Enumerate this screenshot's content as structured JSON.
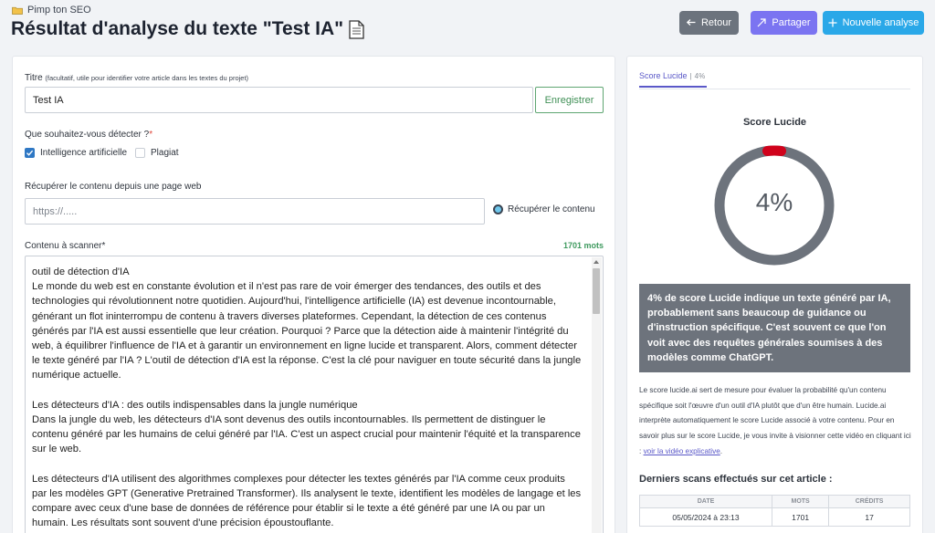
{
  "breadcrumb": {
    "label": "Pimp ton SEO"
  },
  "page": {
    "title": "Résultat d'analyse du texte \"Test IA\""
  },
  "toolbar": {
    "back_label": "Retour",
    "share_label": "Partager",
    "new_label": "Nouvelle analyse"
  },
  "form": {
    "title_label": "Titre",
    "title_hint": "(facultatif, utile pour identifier votre article dans les textes du projet)",
    "title_value": "Test IA",
    "save_label": "Enregistrer",
    "detect_label": "Que souhaitez-vous détecter ?",
    "required_mark": "*",
    "options": [
      {
        "label": "Intelligence artificielle",
        "checked": true
      },
      {
        "label": "Plagiat",
        "checked": false
      }
    ],
    "url_label": "Récupérer le contenu depuis une page web",
    "url_placeholder": "https://.....",
    "fetch_label": "Récupérer le contenu",
    "content_label": "Contenu à scanner*",
    "word_count": "1701 mots",
    "content_paragraphs": [
      "outil de détection d'IA\nLe monde du web est en constante évolution et il n'est pas rare de voir émerger des tendances, des outils et des technologies qui révolutionnent notre quotidien. Aujourd'hui, l'intelligence artificielle (IA) est devenue incontournable, générant un flot ininterrompu de contenu à travers diverses plateformes. Cependant, la détection de ces contenus générés par l'IA est aussi essentielle que leur création. Pourquoi ? Parce que la détection aide à maintenir l'intégrité du web, à équilibrer l'influence de l'IA et à garantir un environnement en ligne lucide et transparent. Alors, comment détecter le texte généré par l'IA ? L'outil de détection d'IA est la réponse. C'est la clé pour naviguer en toute sécurité dans la jungle numérique actuelle.",
      "Les détecteurs d'IA : des outils indispensables dans la jungle numérique\nDans la jungle du web, les détecteurs d'IA sont devenus des outils incontournables. Ils permettent de distinguer le contenu généré par les humains de celui généré par l'IA. C'est un aspect crucial pour maintenir l'équité et la transparence sur le web.",
      "Les détecteurs d'IA utilisent des algorithmes complexes pour détecter les textes générés par l'IA comme ceux produits par les modèles GPT (Generative Pretrained Transformer). Ils analysent le texte, identifient les modèles de langage et les compare avec ceux d'une base de données de référence pour établir si le texte a été généré par une IA ou par un humain. Les résultats sont souvent d'une précision époustouflante."
    ]
  },
  "score_panel": {
    "tab_label": "Score Lucide",
    "tab_separator": "|",
    "tab_pct": "4%",
    "title": "Score Lucide",
    "value_text": "4%",
    "value": 0.04,
    "info": "4% de score Lucide indique un texte généré par IA, probablement sans beaucoup de guidance ou d'instruction spécifique. C'est souvent ce que l'on voit avec des requêtes générales soumises à des modèles comme ChatGPT.",
    "description": "Le score lucide.ai sert de mesure pour évaluer la probabilité qu'un contenu spécifique soit l'œuvre d'un outil d'IA plutôt que d'un être humain. Lucide.ai interprète automatiquement le score Lucide associé à votre contenu. Pour en savoir plus sur le score Lucide, je vous invite à visionner cette vidéo en cliquant ici :",
    "video_link": "voir la vidéo explicative",
    "link_suffix": ".",
    "colors": {
      "track": "#6d737c",
      "indicator": "#d0021b"
    }
  },
  "scans": {
    "title": "Derniers scans effectués sur cet article :",
    "columns": [
      "DATE",
      "MOTS",
      "CRÉDITS"
    ],
    "rows": [
      [
        "05/05/2024 à 23:13",
        "1701",
        "17"
      ]
    ]
  }
}
